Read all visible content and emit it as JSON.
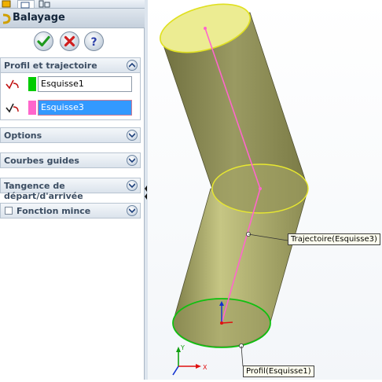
{
  "panel": {
    "title": "Balayage",
    "buttons": {
      "ok": "ok",
      "cancel": "cancel",
      "help": "?"
    },
    "groups": {
      "profil": "Profil et trajectoire",
      "options": "Options",
      "courbes": "Courbes guides",
      "tangence": "Tangence de départ/d'arrivée",
      "mince": "Fonction mince"
    },
    "profil_rows": [
      {
        "value": "Esquisse1",
        "color": "#00cc00"
      },
      {
        "value": "Esquisse3",
        "color": "#ff66cc"
      }
    ]
  },
  "viewport": {
    "callouts": {
      "trajectory": "Trajectoire(Esquisse3)",
      "profile": "Profil(Esquisse1)"
    },
    "colors": {
      "body": "#9a9a5a",
      "top_cap": "#e9e98a",
      "profile_edge": "#00cc00",
      "path": "#ff66cc",
      "triad_x": "#e01010",
      "triad_y": "#10a010",
      "triad_z": "#1030d0"
    }
  }
}
